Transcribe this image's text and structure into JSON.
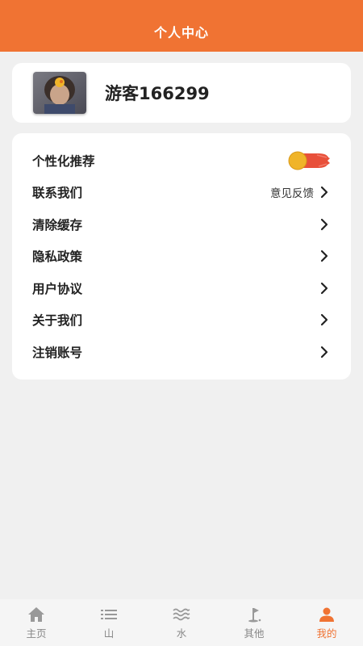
{
  "header": {
    "title": "个人中心"
  },
  "profile": {
    "username": "游客166299",
    "avatar": "avatar-image"
  },
  "menu": {
    "items": [
      {
        "label": "个性化推荐",
        "control": "toggle",
        "toggle_on": true
      },
      {
        "label": "联系我们",
        "hint": "意见反馈",
        "control": "chevron"
      },
      {
        "label": "清除缓存",
        "control": "chevron"
      },
      {
        "label": "隐私政策",
        "control": "chevron"
      },
      {
        "label": "用户协议",
        "control": "chevron"
      },
      {
        "label": "关于我们",
        "control": "chevron"
      },
      {
        "label": "注销账号",
        "control": "chevron"
      }
    ]
  },
  "tabbar": {
    "items": [
      {
        "label": "主页",
        "icon": "home-icon"
      },
      {
        "label": "山",
        "icon": "list-icon"
      },
      {
        "label": "水",
        "icon": "waves-icon"
      },
      {
        "label": "其他",
        "icon": "flag-icon"
      },
      {
        "label": "我的",
        "icon": "person-icon",
        "active": true
      }
    ]
  },
  "colors": {
    "accent": "#f07333",
    "background": "#f0f0f0",
    "toggle_knob": "#f0b429",
    "toggle_track": "#e8503a",
    "tab_inactive": "#888888"
  }
}
